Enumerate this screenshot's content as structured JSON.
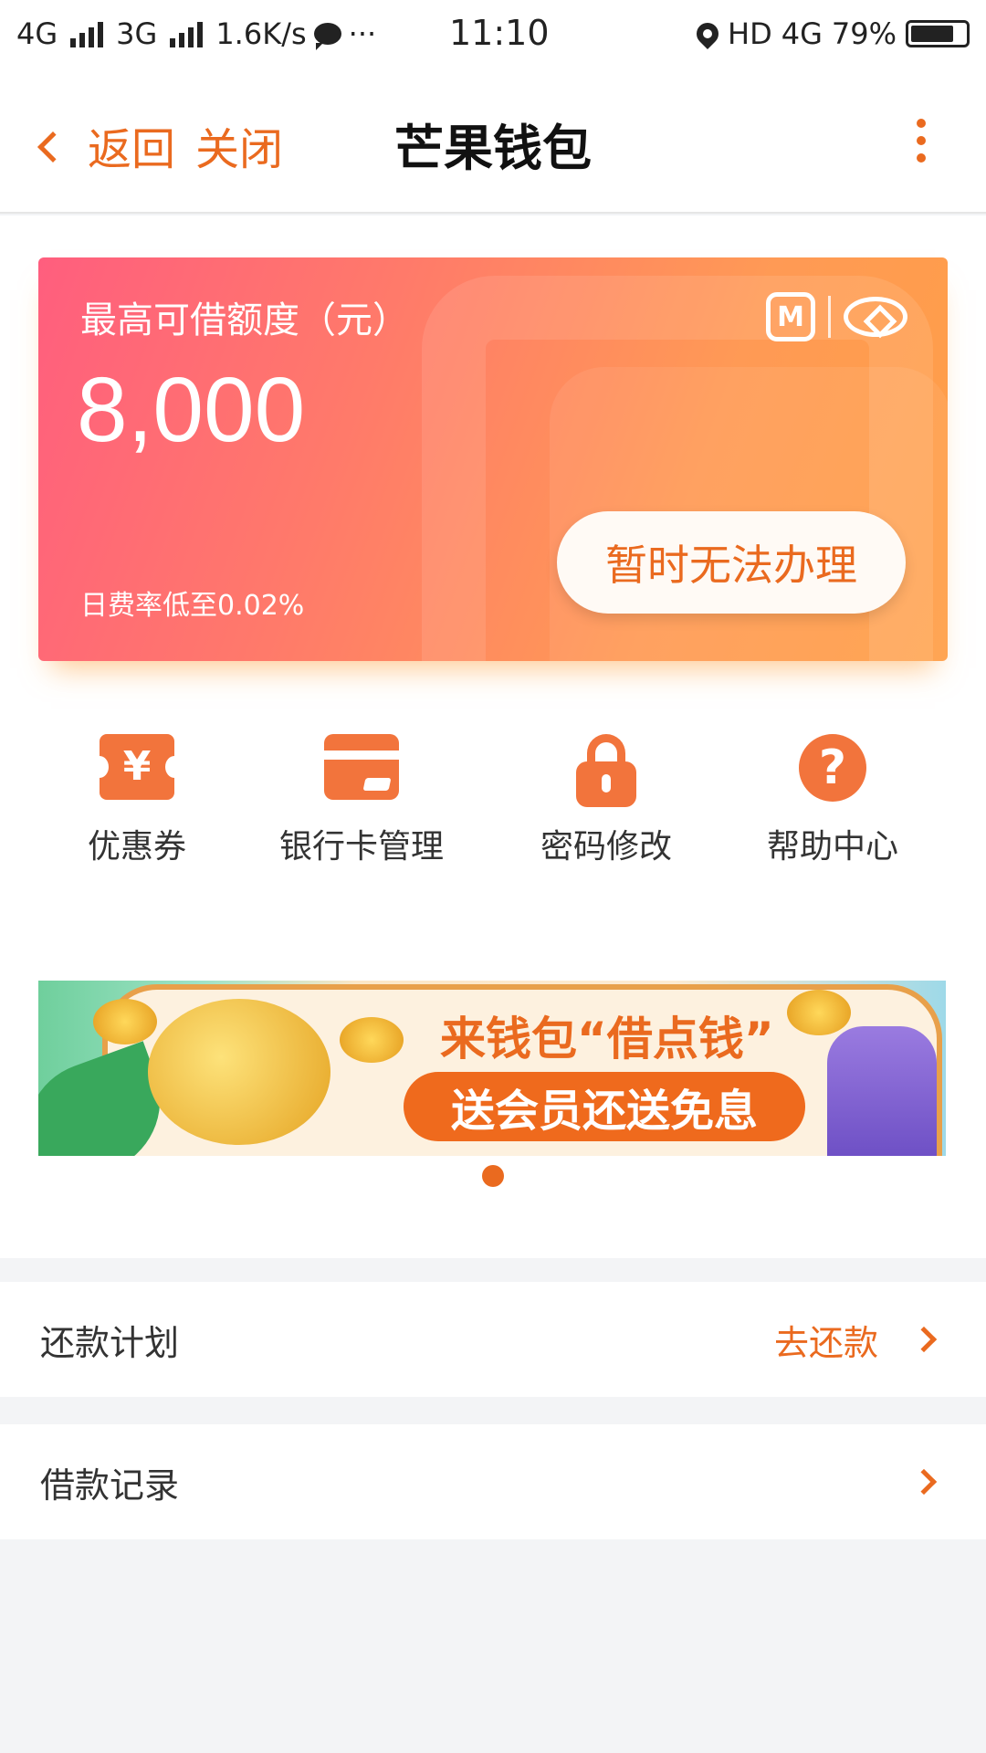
{
  "status_bar": {
    "network_1": "4G",
    "network_2": "3G",
    "speed": "1.6K/s",
    "more": "···",
    "time": "11:10",
    "hd": "HD",
    "net_right": "4G",
    "battery": "79%"
  },
  "header": {
    "back_label": "返回",
    "close_label": "关闭",
    "title": "芒果钱包"
  },
  "credit_card": {
    "label": "最高可借额度（元）",
    "amount": "8,000",
    "rate_text": "日费率低至0.02%",
    "button_label": "暂时无法办理"
  },
  "quick_actions": [
    {
      "label": "优惠券",
      "icon": "coupon-icon"
    },
    {
      "label": "银行卡管理",
      "icon": "bank-card-icon"
    },
    {
      "label": "密码修改",
      "icon": "lock-icon"
    },
    {
      "label": "帮助中心",
      "icon": "help-icon"
    }
  ],
  "banner": {
    "title": "来钱包“借点钱”",
    "subtitle": "送会员还送免息"
  },
  "rows": [
    {
      "label": "还款计划",
      "action": "去还款"
    },
    {
      "label": "借款记录",
      "action": ""
    }
  ],
  "colors": {
    "accent": "#ea6a1f",
    "icon_orange": "#f2743c",
    "card_gradient_start": "#ff5e7e",
    "card_gradient_end": "#ff9f46"
  }
}
